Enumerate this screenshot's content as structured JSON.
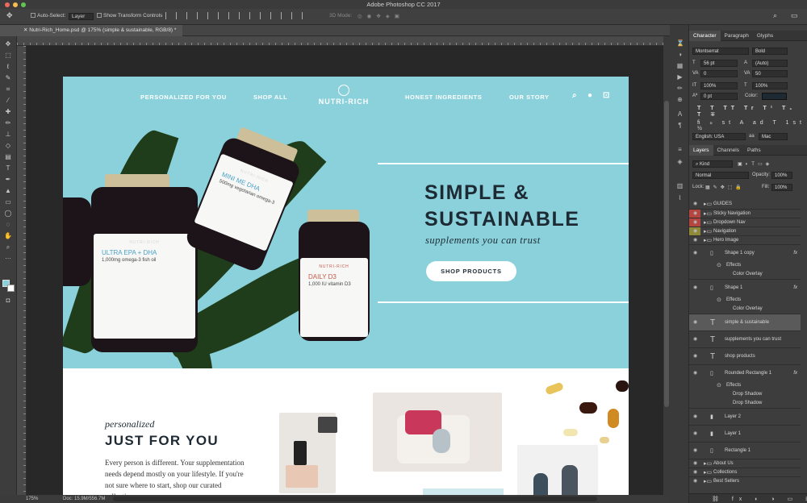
{
  "window": {
    "title": "Adobe Photoshop CC 2017"
  },
  "options_bar": {
    "auto_select_label": "Auto-Select:",
    "auto_select_value": "Layer",
    "show_transform_label": "Show Transform Controls",
    "mode_3d_label": "3D Mode:"
  },
  "document_tab": {
    "label": "Nutri-Rich_Home.psd @ 175% (simple & sustainable, RGB/8) *"
  },
  "status_bar": {
    "zoom": "175%",
    "doc_size": "Doc: 15.9M/556.7M"
  },
  "design": {
    "nav": {
      "left_items": [
        "PERSONALIZED FOR YOU",
        "SHOP ALL"
      ],
      "logo": "NUTRI-RICH",
      "right_items": [
        "HONEST INGREDIENTS",
        "OUR STORY"
      ]
    },
    "hero": {
      "headline_line1": "SIMPLE &",
      "headline_line2": "SUSTAINABLE",
      "subheadline": "supplements you can trust",
      "cta": "SHOP PRODUCTS"
    },
    "jars": [
      {
        "brand": "NUTRI-RICH",
        "product": "ULTRA EPA + DHA",
        "desc": "1,000mg omega-3 fish oil"
      },
      {
        "brand": "NUTRI-RICH",
        "product": "MINI ME DHA",
        "desc": "500mg vegetarian omega-3"
      },
      {
        "brand": "NUTRI-RICH",
        "product": "DAILY D3",
        "desc": "1,000 IU vitamin D3"
      }
    ],
    "section2": {
      "kicker": "personalized",
      "title": "JUST FOR YOU",
      "body": "Every person is different. Your supplementation needs depend mostly on your lifestyle. If you're not sure where to start, shop our curated collections."
    },
    "colors": {
      "hero_bg": "#8ad1db",
      "text_dark": "#1d2a33",
      "leaf": "#1f3d1a"
    }
  },
  "character_panel": {
    "tabs": [
      "Character",
      "Paragraph",
      "Glyphs"
    ],
    "font_family": "Montserrat",
    "font_style": "Bold",
    "font_size": "56 pt",
    "leading": "(Auto)",
    "kerning": "0",
    "tracking": "50",
    "vertical_scale": "100%",
    "horizontal_scale": "100%",
    "baseline": "0 pt",
    "color_label": "Color:",
    "language": "English: USA",
    "antialias": "Mac"
  },
  "layers_panel": {
    "tabs": [
      "Layers",
      "Channels",
      "Paths"
    ],
    "filter_kind": "Kind",
    "blend_mode": "Normal",
    "opacity_label": "Opacity:",
    "opacity": "100%",
    "lock_label": "Lock:",
    "fill_label": "Fill:",
    "fill": "100%",
    "layers": [
      {
        "name": "GUIDES",
        "type": "group",
        "indent": 0
      },
      {
        "name": "Sticky Navigation",
        "type": "group",
        "indent": 0,
        "tag": "#b4453f"
      },
      {
        "name": "Dropdown Nav",
        "type": "group",
        "indent": 0,
        "tag": "#b4453f"
      },
      {
        "name": "Navigation",
        "type": "group",
        "indent": 0,
        "tag": "#8f8a3a"
      },
      {
        "name": "Hero Image",
        "type": "group",
        "indent": 0
      },
      {
        "name": "Shape 1 copy",
        "type": "shape",
        "indent": 1
      },
      {
        "name": "Effects",
        "type": "effect",
        "indent": 2
      },
      {
        "name": "Color Overlay",
        "type": "effect",
        "indent": 3
      },
      {
        "name": "Shape 1",
        "type": "shape",
        "indent": 1
      },
      {
        "name": "Effects",
        "type": "effect",
        "indent": 2
      },
      {
        "name": "Color Overlay",
        "type": "effect",
        "indent": 3
      },
      {
        "name": "simple & sustainable",
        "type": "text",
        "indent": 1,
        "selected": true
      },
      {
        "name": "supplements you can trust",
        "type": "text",
        "indent": 1
      },
      {
        "name": "shop products",
        "type": "text",
        "indent": 1
      },
      {
        "name": "Rounded Rectangle 1",
        "type": "shape",
        "indent": 1
      },
      {
        "name": "Effects",
        "type": "effect",
        "indent": 2
      },
      {
        "name": "Drop Shadow",
        "type": "effect",
        "indent": 3
      },
      {
        "name": "Drop Shadow",
        "type": "effect",
        "indent": 3
      },
      {
        "name": "Layer 2",
        "type": "pixel",
        "indent": 1
      },
      {
        "name": "Layer 1",
        "type": "pixel",
        "indent": 1
      },
      {
        "name": "Rectangle 1",
        "type": "shape",
        "indent": 1
      },
      {
        "name": "About Us",
        "type": "group",
        "indent": 0
      },
      {
        "name": "Collections",
        "type": "group",
        "indent": 0
      },
      {
        "name": "Best Sellers",
        "type": "group",
        "indent": 0
      }
    ]
  }
}
